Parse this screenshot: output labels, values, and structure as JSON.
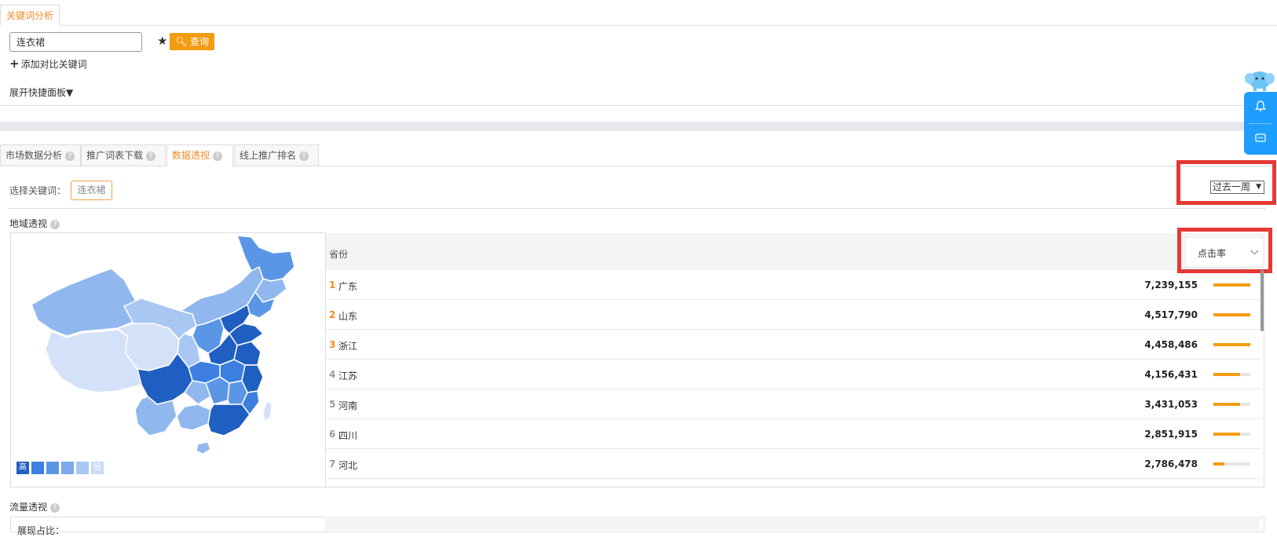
{
  "top_tab": "关键词分析",
  "search": {
    "value": "连衣裙",
    "button": "查询"
  },
  "add_compare": "添加对比关键词",
  "expand_panel": "展开快捷面板",
  "subtabs": [
    {
      "label": "市场数据分析"
    },
    {
      "label": "推广词表下载"
    },
    {
      "label": "数据透视"
    },
    {
      "label": "线上推广排名"
    }
  ],
  "filters": {
    "select_kw_label": "选择关键词：",
    "chip": "连衣裙",
    "period": "过去一周"
  },
  "region": {
    "title": "地域透视",
    "column_header": "省份",
    "metric": "点击率",
    "legend": {
      "high": "高",
      "low": "低"
    },
    "rows": [
      {
        "rank": "1",
        "province": "广东",
        "value": "7,239,155",
        "bar": 1.0
      },
      {
        "rank": "2",
        "province": "山东",
        "value": "4,517,790",
        "bar": 1.0
      },
      {
        "rank": "3",
        "province": "浙江",
        "value": "4,458,486",
        "bar": 1.0
      },
      {
        "rank": "4",
        "province": "江苏",
        "value": "4,156,431",
        "bar": 0.72
      },
      {
        "rank": "5",
        "province": "河南",
        "value": "3,431,053",
        "bar": 0.72
      },
      {
        "rank": "6",
        "province": "四川",
        "value": "2,851,915",
        "bar": 0.72
      },
      {
        "rank": "7",
        "province": "河北",
        "value": "2,786,478",
        "bar": 0.3
      }
    ]
  },
  "flow": {
    "title": "流量透视",
    "label": "展现占比："
  },
  "colors": {
    "accent": "#f08a24",
    "bar": "#f39c12",
    "rank_top": "#f08a24",
    "rank_other": "#999999",
    "highlight": "#e53935"
  }
}
